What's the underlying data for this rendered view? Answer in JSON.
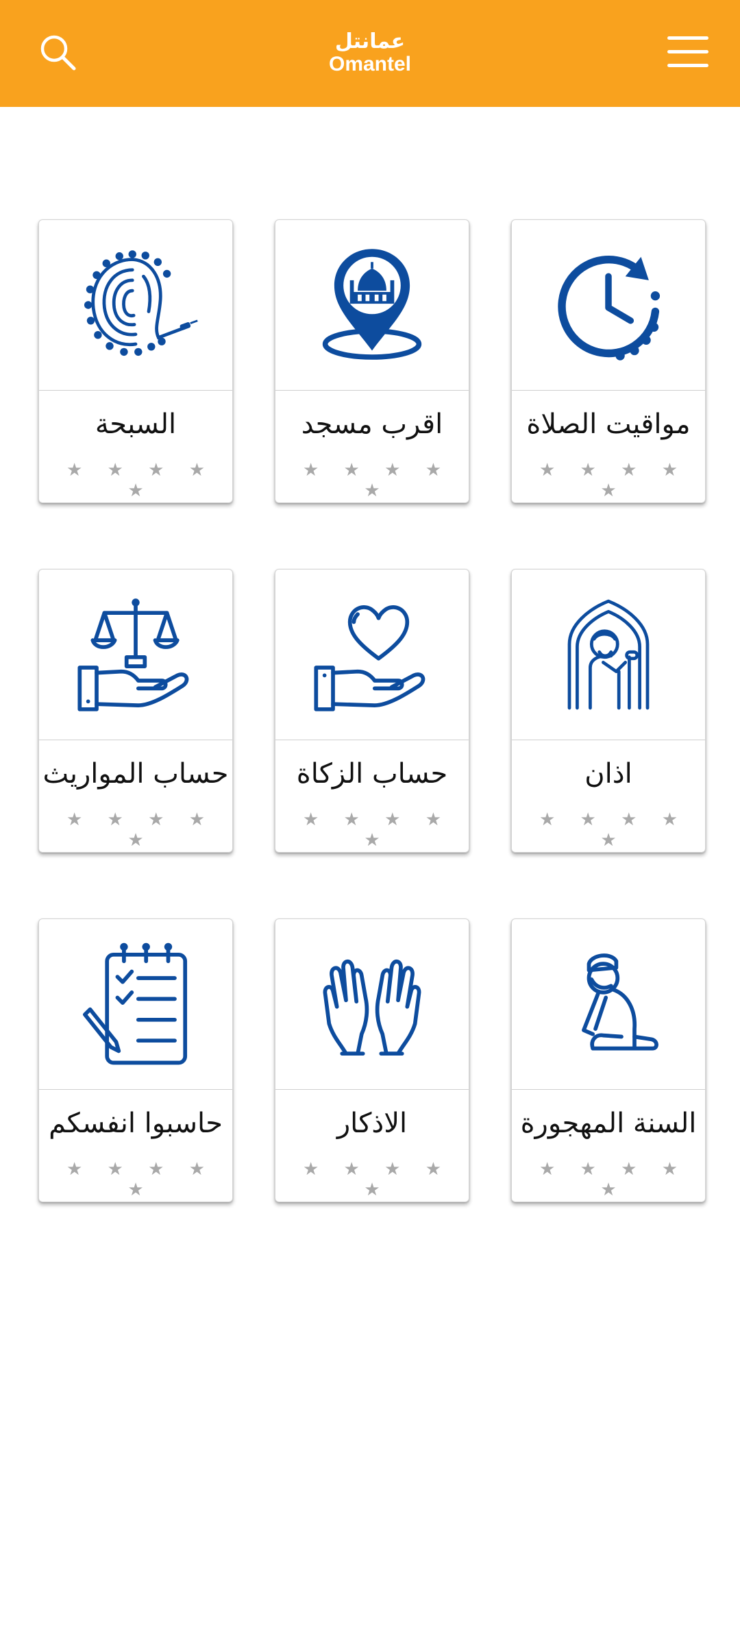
{
  "header": {
    "logo_ar": "عمانتل",
    "logo_en": "Omantel",
    "brand_color": "#F9A21E",
    "search_icon": "search-icon",
    "menu_icon": "hamburger-menu-icon"
  },
  "icon_color": "#0D4C9E",
  "star_glyph": "★ ★ ★ ★ ★",
  "tiles": [
    {
      "title": "السبحة",
      "icon": "prayer-beads-fingerprint-icon",
      "rating": 0
    },
    {
      "title": "اقرب مسجد",
      "icon": "mosque-location-pin-icon",
      "rating": 0
    },
    {
      "title": "مواقيت الصلاة",
      "icon": "clock-icon",
      "rating": 0
    },
    {
      "title": "حساب المواريث",
      "icon": "scales-in-hand-icon",
      "rating": 0
    },
    {
      "title": "حساب الزكاة",
      "icon": "heart-in-hand-icon",
      "rating": 0
    },
    {
      "title": "اذان",
      "icon": "muezzin-icon",
      "rating": 0
    },
    {
      "title": "حاسبوا انفسكم",
      "icon": "checklist-notepad-icon",
      "rating": 0
    },
    {
      "title": "الاذكار",
      "icon": "praying-hands-icon",
      "rating": 0
    },
    {
      "title": "السنة المهجورة",
      "icon": "kneeling-prayer-icon",
      "rating": 0
    }
  ]
}
